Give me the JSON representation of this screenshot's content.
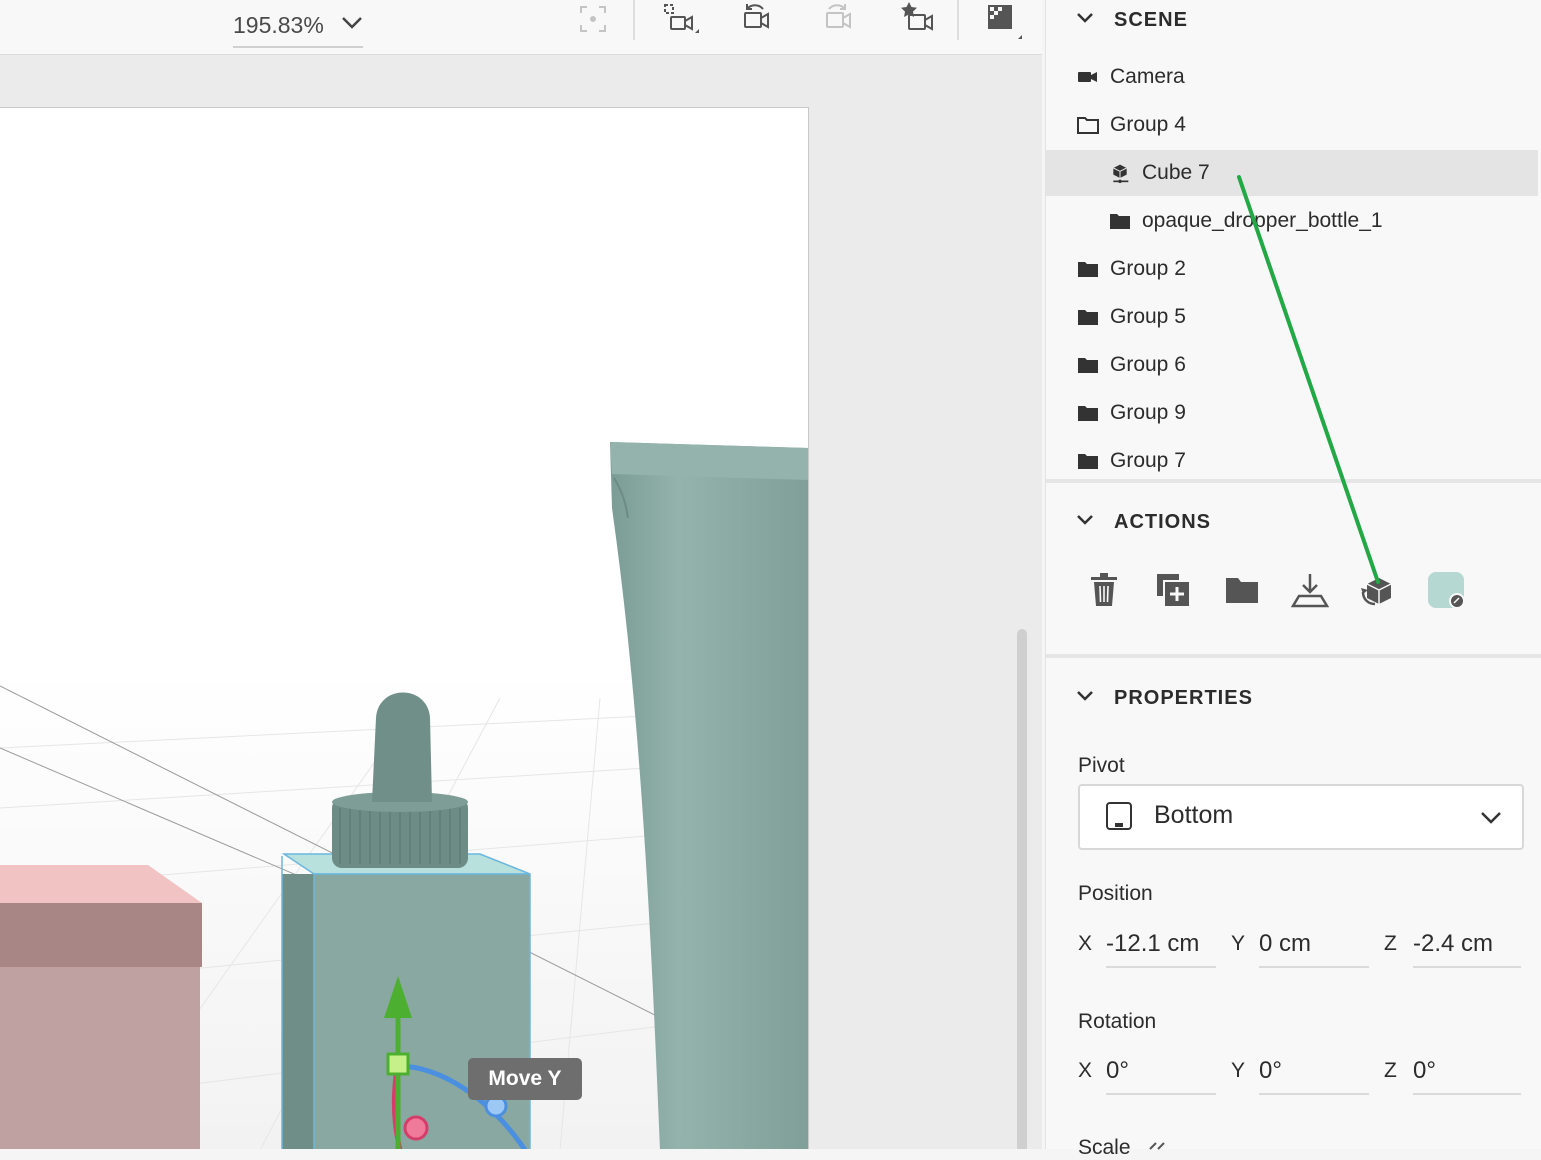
{
  "toolbar": {
    "zoom_value": "195.83%"
  },
  "viewport": {
    "gizmo_tooltip": "Move Y"
  },
  "scene": {
    "title": "SCENE",
    "items": [
      {
        "label": "Camera",
        "icon": "camera-icon"
      },
      {
        "label": "Group 4",
        "icon": "folder-outline-icon"
      },
      {
        "label": "Cube 7",
        "icon": "cube-object-icon",
        "selected": true
      },
      {
        "label": "opaque_dropper_bottle_1",
        "icon": "folder-icon"
      },
      {
        "label": "Group 2",
        "icon": "folder-icon"
      },
      {
        "label": "Group 5",
        "icon": "folder-icon"
      },
      {
        "label": "Group 6",
        "icon": "folder-icon"
      },
      {
        "label": "Group 9",
        "icon": "folder-icon"
      },
      {
        "label": "Group 7",
        "icon": "folder-icon"
      }
    ]
  },
  "actions": {
    "title": "ACTIONS",
    "buttons": [
      "trash-icon",
      "duplicate-icon",
      "group-folder-icon",
      "drop-to-ground-icon",
      "replace-object-icon",
      "material-swatch-icon"
    ]
  },
  "properties": {
    "title": "PROPERTIES",
    "pivot_label": "Pivot",
    "pivot_value": "Bottom",
    "position_label": "Position",
    "position": {
      "x_axis": "X",
      "x": "-12.1 cm",
      "y_axis": "Y",
      "y": "0 cm",
      "z_axis": "Z",
      "z": "-2.4 cm"
    },
    "rotation_label": "Rotation",
    "rotation": {
      "x_axis": "X",
      "x": "0°",
      "y_axis": "Y",
      "y": "0°",
      "z_axis": "Z",
      "z": "0°"
    },
    "scale_label": "Scale"
  },
  "colors": {
    "bottle_teal": "#8aaba4",
    "pink_box": "#c9a0a0",
    "gizmo_green": "#4caf30",
    "gizmo_red": "#d63d6a",
    "gizmo_blue": "#4a8fe0",
    "annotation_line": "#22a845"
  }
}
